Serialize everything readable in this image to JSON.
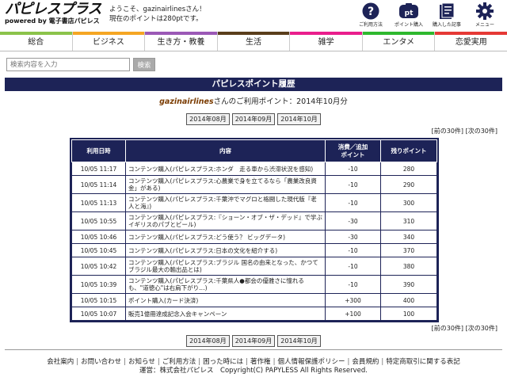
{
  "logo": {
    "main": "パピレスプラス",
    "sub": "powered by 電子書店パピレス"
  },
  "welcome": {
    "line1": "ようこそ、gazinairlinesさん！",
    "line2": "現在のポイントは280ptです。"
  },
  "header_icons": [
    {
      "icon": "help-icon",
      "label": "ご利用方法"
    },
    {
      "icon": "points-icon",
      "label": "ポイント購入",
      "badge": "pt"
    },
    {
      "icon": "purchased-articles-icon",
      "label": "購入した記事"
    },
    {
      "icon": "gear-icon",
      "label": "メニュー"
    }
  ],
  "nav": [
    {
      "label": "総合",
      "color": "#8bc34a"
    },
    {
      "label": "ビジネス",
      "color": "#f5a623"
    },
    {
      "label": "生き方・教養",
      "color": "#9b59b6"
    },
    {
      "label": "生活",
      "color": "#5a3e1b"
    },
    {
      "label": "雑学",
      "color": "#e91e8c"
    },
    {
      "label": "エンタメ",
      "color": "#2eb82e"
    },
    {
      "label": "恋愛実用",
      "color": "#e53935"
    }
  ],
  "search": {
    "placeholder": "検索内容を入力",
    "button": "検索"
  },
  "page_title": "パピレスポイント履歴",
  "usage": {
    "username": "gazinairlines",
    "suffix": "さんのご利用ポイント：2014年10月分"
  },
  "months": [
    "2014年08月",
    "2014年09月",
    "2014年10月"
  ],
  "pager": {
    "prev": "[前の30件]",
    "next": "[次の30件]"
  },
  "table": {
    "headers": {
      "date": "利用日時",
      "content": "内容",
      "used": "消費／追加\nポイント",
      "remaining": "残りポイント"
    },
    "rows": [
      {
        "date": "10/05 11:17",
        "content": "コンテンツ購入(パピレスプラス:ホンダ　走る車から渋滞状況を感知)",
        "used": "-10",
        "remaining": "280"
      },
      {
        "date": "10/05 11:14",
        "content": "コンテンツ購入(パピレスプラス:心農業で身を立てるなら「農業改良資金」がある)",
        "used": "-10",
        "remaining": "290"
      },
      {
        "date": "10/05 11:13",
        "content": "コンテンツ購入(パピレスプラス:千葉沖でマグロと格闘した現代版『老人と海』)",
        "used": "-10",
        "remaining": "300"
      },
      {
        "date": "10/05 10:55",
        "content": "コンテンツ購入(パピレスプラス:『ショーン・オブ・ザ・デッド』で学ぶ イギリスのパブとビール)",
        "used": "-30",
        "remaining": "310"
      },
      {
        "date": "10/05 10:46",
        "content": "コンテンツ購入(パピレスプラス:どう使う？ ビッグデータ)",
        "used": "-30",
        "remaining": "340"
      },
      {
        "date": "10/05 10:45",
        "content": "コンテンツ購入(パピレスプラス:日本の文化を紹介する)",
        "used": "-10",
        "remaining": "370"
      },
      {
        "date": "10/05 10:42",
        "content": "コンテンツ購入(パピレスプラス:ブラジル 国名の由来となった、かつてブラジル最大の輸出品とは)",
        "used": "-10",
        "remaining": "380"
      },
      {
        "date": "10/05 10:39",
        "content": "コンテンツ購入(パピレスプラス:千葉県人●都会の優雅さに憧れるも、\"道徳心\"は右肩下がり…)",
        "used": "-10",
        "remaining": "390"
      },
      {
        "date": "10/05 10:15",
        "content": "ポイント購入(カード決済)",
        "used": "+300",
        "remaining": "400"
      },
      {
        "date": "10/05 10:07",
        "content": "販売1億冊達成記念入会キャンペーン",
        "used": "+100",
        "remaining": "100"
      }
    ]
  },
  "footer": {
    "links": [
      "会社案内",
      "お問い合わせ",
      "お知らせ",
      "ご利用方法",
      "困った時には",
      "著作権",
      "個人情報保護ポリシー",
      "会員規約",
      "特定商取引に関する表記"
    ],
    "copyright": "運営：株式会社パピレス　Copyright(C) PAPYLESS All Rights Reserved."
  }
}
